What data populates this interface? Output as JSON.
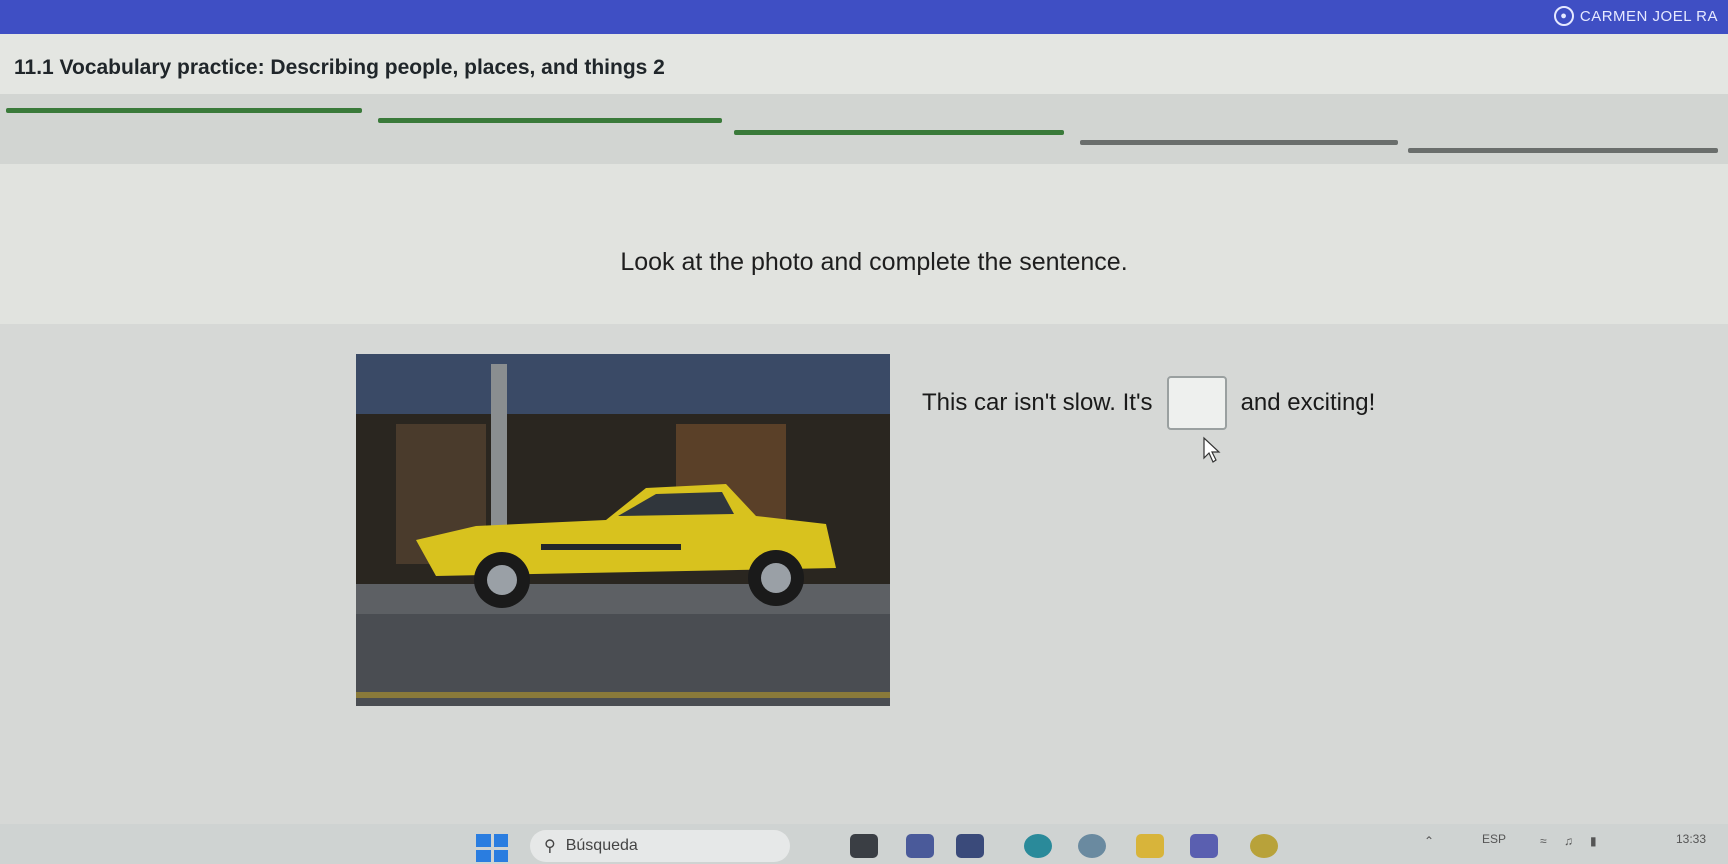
{
  "user": {
    "name": "CARMEN JOEL RA"
  },
  "header": {
    "title": "11.1 Vocabulary practice: Describing people, places, and things 2"
  },
  "progress": {
    "segments": [
      {
        "status": "complete",
        "color": "#3a7a3a"
      },
      {
        "status": "complete",
        "color": "#3a7a3a"
      },
      {
        "status": "complete",
        "color": "#3a7a3a"
      },
      {
        "status": "incomplete",
        "color": "#6a6e6c"
      },
      {
        "status": "incomplete",
        "color": "#6a6e6c"
      }
    ]
  },
  "exercise": {
    "instruction": "Look at the photo and complete the sentence.",
    "photo_alt": "yellow car",
    "sentence_before": "This car isn't slow. It's",
    "answer_value": "",
    "sentence_after": "and exciting!"
  },
  "taskbar": {
    "search_placeholder": "Búsqueda",
    "language": "ESP",
    "time": "13:33"
  },
  "colors": {
    "accent": "#3f4fc4",
    "progress_done": "#3a7a3a"
  }
}
